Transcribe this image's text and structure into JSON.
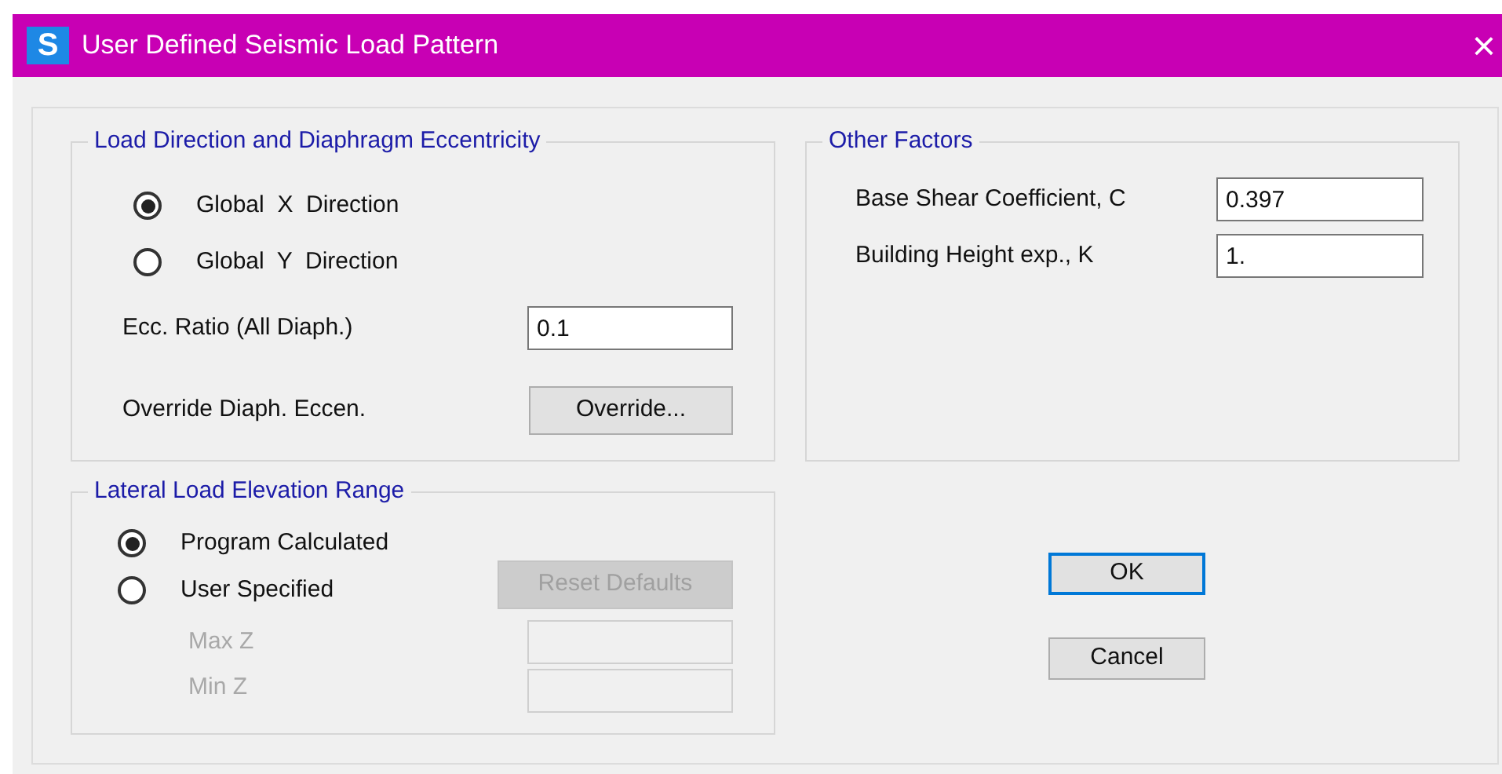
{
  "window": {
    "icon": "S",
    "title": "User Defined Seismic Load Pattern",
    "close": "×"
  },
  "load_direction": {
    "title": "Load Direction and Diaphragm Eccentricity",
    "options": [
      {
        "label": "Global  X  Direction",
        "selected": true
      },
      {
        "label": "Global  Y  Direction",
        "selected": false
      }
    ],
    "ecc_ratio": {
      "label": "Ecc. Ratio (All Diaph.)",
      "value": "0.1"
    },
    "override": {
      "label": "Override Diaph. Eccen.",
      "button": "Override..."
    }
  },
  "other_factors": {
    "title": "Other Factors",
    "fields": [
      {
        "label": "Base Shear Coefficient, C",
        "value": "0.397"
      },
      {
        "label": "Building Height exp., K",
        "value": "1."
      }
    ]
  },
  "elevation_range": {
    "title": "Lateral Load Elevation Range",
    "options": [
      {
        "label": "Program Calculated",
        "selected": true
      },
      {
        "label": "User Specified",
        "selected": false
      }
    ],
    "reset_button": {
      "label": "Reset Defaults",
      "disabled": true
    },
    "fields": [
      {
        "label": "Max Z",
        "disabled": true
      },
      {
        "label": "Min Z",
        "disabled": true
      }
    ]
  },
  "buttons": [
    {
      "label": "OK",
      "focused": true
    },
    {
      "label": "Cancel",
      "focused": false
    }
  ]
}
